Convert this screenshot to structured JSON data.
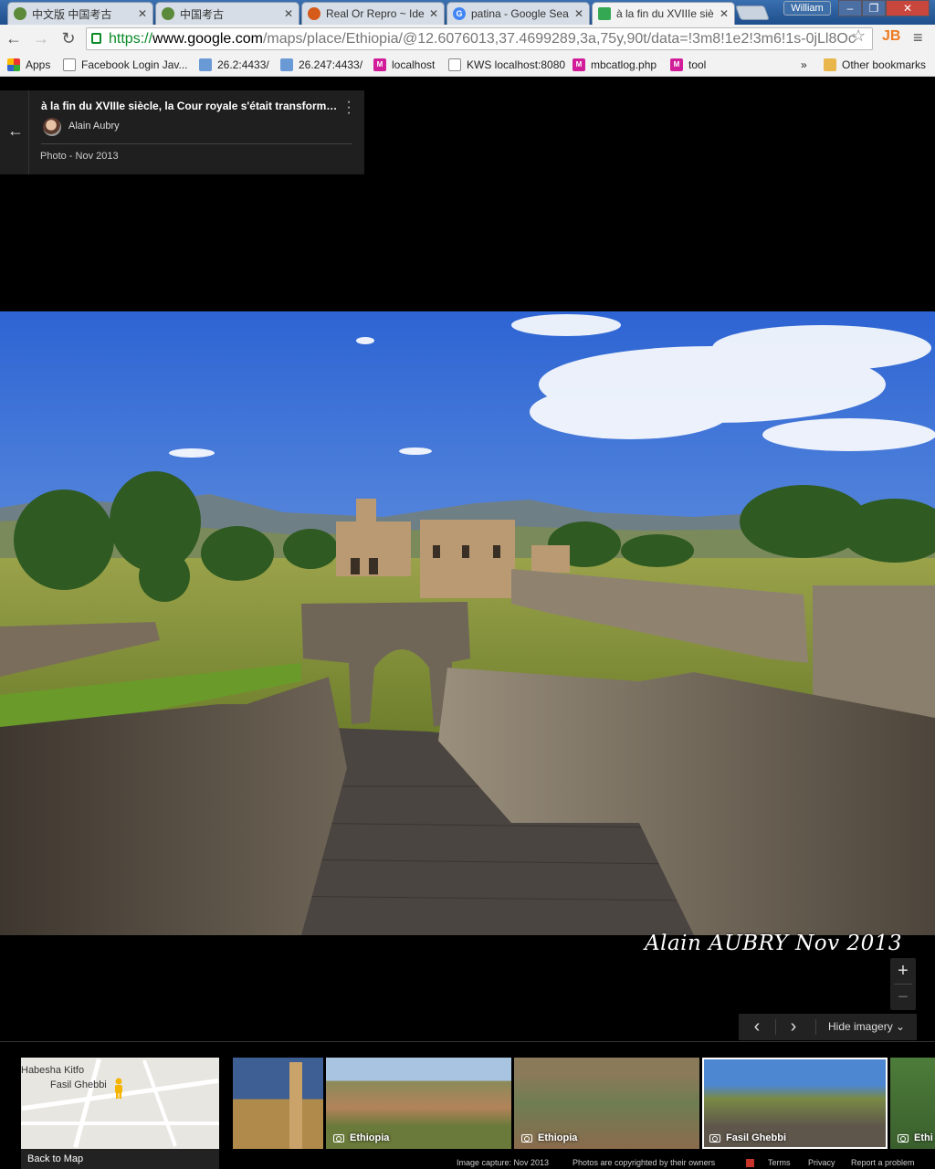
{
  "browser": {
    "tabs": [
      {
        "title": "中文版 中国考古",
        "favicon_color": "#5a8a3a"
      },
      {
        "title": "中国考古",
        "favicon_color": "#5a8a3a"
      },
      {
        "title": "Real Or Repro ~ Ide",
        "favicon_color": "#d65a1a"
      },
      {
        "title": "patina - Google Sea",
        "favicon_color": "#4285f4"
      },
      {
        "title": "à la fin du XVIIIe siè",
        "favicon_color": "#34a853"
      }
    ],
    "close_glyph": "✕",
    "user_name": "William",
    "url": {
      "scheme": "https://",
      "host": "www.google.com",
      "path": "/maps/place/Ethiopia/@12.6076013,37.4699289,3a,75y,90t/data=!3m8!1e2!3m6!1s-0jLl8Oc"
    },
    "extension_label": "JB",
    "bookmarks": [
      {
        "label": "Apps",
        "icon": "apps-icon"
      },
      {
        "label": "Facebook Login Jav...",
        "icon": "page-icon"
      },
      {
        "label": "26.2:4433/",
        "icon": "globe-icon"
      },
      {
        "label": "26.247:4433/",
        "icon": "globe-icon"
      },
      {
        "label": "localhost",
        "icon": "m-icon"
      },
      {
        "label": "KWS localhost:8080",
        "icon": "page-icon"
      },
      {
        "label": "mbcatlog.php",
        "icon": "m-icon"
      },
      {
        "label": "tool",
        "icon": "m-icon"
      }
    ],
    "bookmarks_overflow": "»",
    "other_bookmarks": "Other bookmarks"
  },
  "photo_card": {
    "title": "à la fin du XVIIIe siècle, la Cour royale s'était transformée ...",
    "author": "Alain Aubry",
    "date": "Photo - Nov 2013"
  },
  "photo": {
    "watermark": "Alain AUBRY Nov 2013",
    "colors": {
      "sky": "#2f6fd6",
      "grass": "#8a9a3a",
      "stone": "#6b5e50"
    }
  },
  "controls": {
    "zoom_in": "+",
    "zoom_out": "−",
    "prev": "‹",
    "next": "›",
    "hide_imagery": "Hide imagery"
  },
  "minimap": {
    "place1": "Habesha Kitfo",
    "place2": "Fasil Ghebbi",
    "back_to_map": "Back to Map"
  },
  "thumbnails": [
    {
      "label": "",
      "colors": [
        "#3d5f94",
        "#b08a4a"
      ]
    },
    {
      "label": "Ethiopia",
      "colors": [
        "#7fa3c9",
        "#b3835a"
      ]
    },
    {
      "label": "Ethiopia",
      "colors": [
        "#6f7d52",
        "#8a6b4d"
      ]
    },
    {
      "label": "Fasil Ghebbi",
      "colors": [
        "#4d86d1",
        "#7a8a45"
      ]
    },
    {
      "label": "Ethi",
      "colors": [
        "#4d7d3a",
        "#3a5f2d"
      ]
    }
  ],
  "footer": {
    "capture": "Image capture: Nov 2013",
    "copyright": "Photos are copyrighted by their owners",
    "terms": "Terms",
    "privacy": "Privacy",
    "report": "Report a problem"
  }
}
